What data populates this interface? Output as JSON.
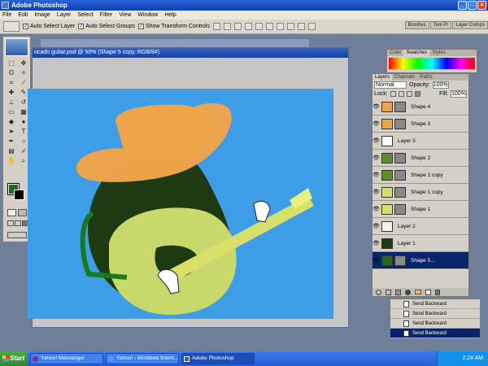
{
  "window": {
    "title": "Adobe Photoshop"
  },
  "menu": [
    "File",
    "Edit",
    "Image",
    "Layer",
    "Select",
    "Filter",
    "View",
    "Window",
    "Help"
  ],
  "options": {
    "auto_select_layer": "Auto Select Layer",
    "auto_select_groups": "Auto Select Groups",
    "show_transform": "Show Transform Controls"
  },
  "wells": [
    "Brushes",
    "Tool Pr",
    "Layer Comps"
  ],
  "document": {
    "title": "ocado guitar.psd @ 50% (Shape 5 copy, RGB/8#)"
  },
  "color_tabs": [
    "Color",
    "Swatches",
    "Styles"
  ],
  "layers_panel": {
    "tabs": [
      "Layers",
      "Channels",
      "Paths"
    ],
    "blend_mode": "Normal",
    "opacity_label": "Opacity:",
    "opacity": "100%",
    "lock_label": "Lock:",
    "fill_label": "Fill:",
    "fill": "100%",
    "layers": [
      {
        "name": "Shape 4",
        "color": "#f0a44a"
      },
      {
        "name": "Shape 3",
        "color": "#f0a44a"
      },
      {
        "name": "Layer 3",
        "color": "#ffffff"
      },
      {
        "name": "Shape 2",
        "color": "#5f8d2a"
      },
      {
        "name": "Shape 2 copy",
        "color": "#5f8d2a"
      },
      {
        "name": "Shape 1 copy",
        "color": "#d8e06a"
      },
      {
        "name": "Shape 1",
        "color": "#d8e06a"
      },
      {
        "name": "Layer 2",
        "color": "#f4f4e0"
      },
      {
        "name": "Layer 1",
        "color": "#1e3a12"
      },
      {
        "name": "Shape 5...",
        "color": "#1e6a20"
      }
    ]
  },
  "history": [
    "Send Backward",
    "Send Backward",
    "Send Backward",
    "Send Backward"
  ],
  "taskbar": {
    "start": "Start",
    "tasks": [
      "Yahoo! Messenger",
      "Yahoo! - Windows Intern...",
      "Adobe Photoshop"
    ],
    "clock": "2:24 AM"
  },
  "colors": {
    "canvas_bg": "#3d9de7",
    "hat": "#f0a44a",
    "avocado_dark": "#1e3a12",
    "avocado_flesh": "#c8d86a",
    "neck": "#d8e06a",
    "arm": "#1a7a1a"
  }
}
